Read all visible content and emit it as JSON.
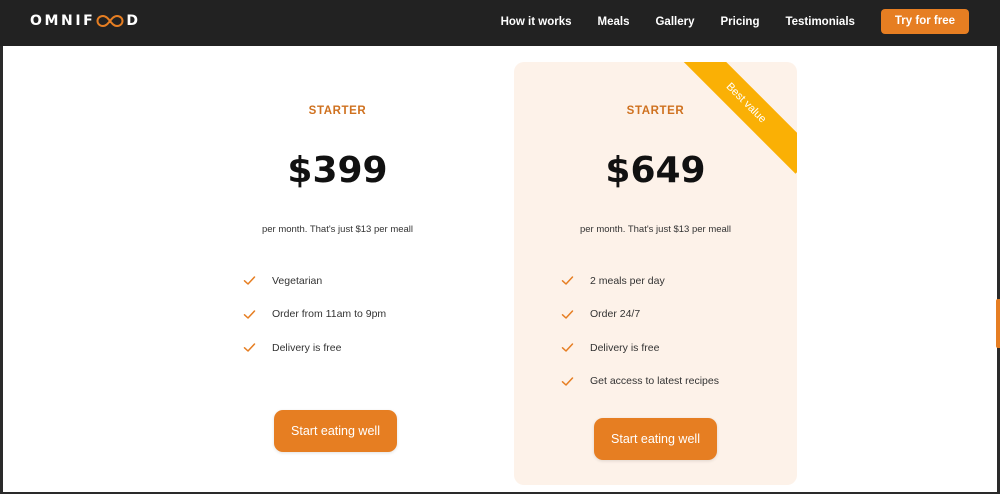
{
  "brand": {
    "prefix": "OMNIF",
    "suffix": "D",
    "accent": "#e67e22"
  },
  "nav": {
    "links": [
      "How it works",
      "Meals",
      "Gallery",
      "Pricing",
      "Testimonials"
    ],
    "cta": "Try for free"
  },
  "plans": [
    {
      "name": "STARTER",
      "price": "$399",
      "note": "per month. That's just $13 per meall",
      "features": [
        "Vegetarian",
        "Order from 11am to 9pm",
        "Delivery is free"
      ],
      "button": "Start eating well"
    },
    {
      "name": "STARTER",
      "price": "$649",
      "note": "per month. That's just $13 per meall",
      "features": [
        "2 meals per day",
        "Order 24/7",
        "Delivery is free",
        "Get access to latest recipes"
      ],
      "button": "Start eating well",
      "ribbon": "Best value"
    }
  ],
  "icons": {
    "feature": "checkmark-icon",
    "logo": "infinity-icon"
  },
  "colors": {
    "navbar": "#222222",
    "best_card_bg": "#fdf2e9",
    "ribbon": "#fab005",
    "plan_name": "#cf711f"
  }
}
